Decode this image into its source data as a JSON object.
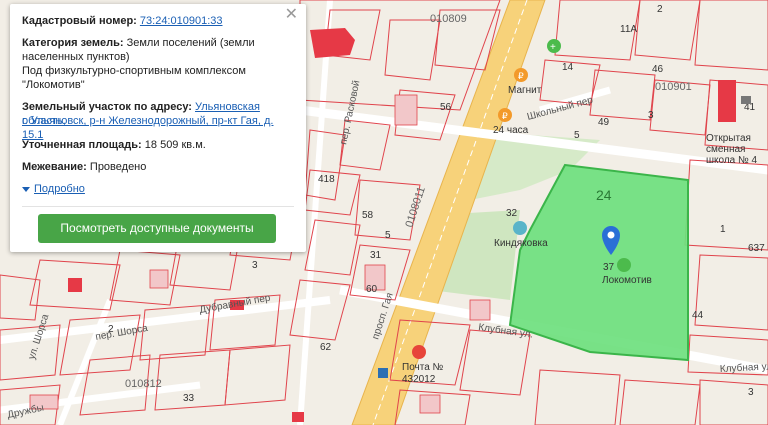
{
  "popup": {
    "cadastral_label": "Кадастровый номер:",
    "cadastral_value": "73:24:010901:33",
    "category_label": "Категория земель:",
    "category_value_1": "Земли поселений (земли",
    "category_value_2": "населенных пунктов)",
    "usage_1": "Под физкультурно-спортивным комплексом",
    "usage_2": "\"Локомотив\"",
    "address_label": "Земельный участок по адресу:",
    "address_value_1": "Ульяновская область,",
    "address_value_2": "г. Ульяновск, р-н Железнодорожный, пр-кт Гая, д. 15.1",
    "area_label": "Уточненная площадь:",
    "area_value": "18 509 кв.м.",
    "survey_label": "Межевание:",
    "survey_value": "Проведено",
    "details_link": "Подробно",
    "docs_button": "Посмотреть доступные документы",
    "close_icon": "close-icon"
  },
  "map": {
    "cadastral_blocks": [
      "010809",
      "010901",
      "010812",
      "0108011"
    ],
    "parcel_numbers": [
      "24",
      "14",
      "46",
      "41",
      "2",
      "11А",
      "3",
      "56",
      "49",
      "5",
      "32",
      "418",
      "58",
      "5",
      "60",
      "62",
      "31",
      "44",
      "637",
      "33",
      "37",
      "3",
      "1"
    ],
    "streets": [
      "пер. Расковой",
      "Школьный пер",
      "Дубравный пер",
      "пер. Шорса",
      "Клубная ул.",
      "Клубная ул",
      "просп. Гая",
      "ул. Шорса",
      "Дружбы"
    ],
    "pois": [
      "Магнит",
      "24 часа",
      "Киндяковка",
      "Локомотив",
      "Почта №",
      "432012",
      "Открытая",
      "сменная",
      "школа № 4"
    ],
    "colors": {
      "parcel_fill": "#6ee07e",
      "parcel_stroke": "#3bb54a",
      "park": "#cfe6c0",
      "road": "#f5c86b",
      "boundary": "#e0444c",
      "building": "#e63946",
      "marker": "#2a6fd6"
    }
  }
}
